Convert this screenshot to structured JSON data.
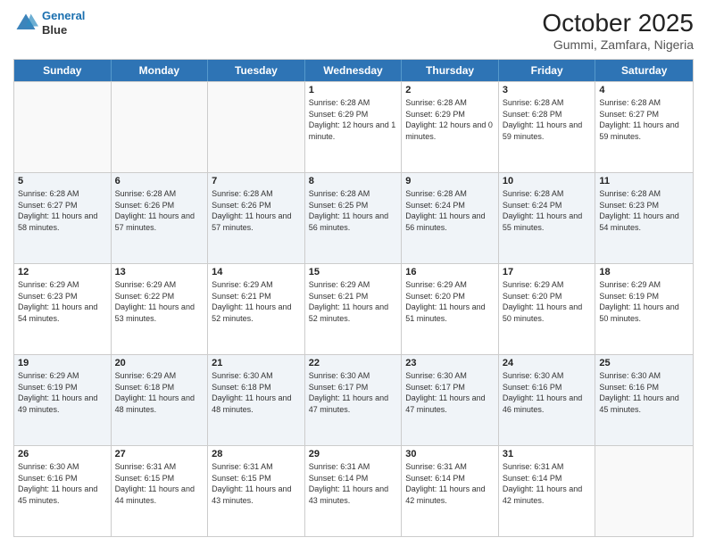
{
  "header": {
    "logo_line1": "General",
    "logo_line2": "Blue",
    "main_title": "October 2025",
    "subtitle": "Gummi, Zamfara, Nigeria"
  },
  "calendar": {
    "days": [
      "Sunday",
      "Monday",
      "Tuesday",
      "Wednesday",
      "Thursday",
      "Friday",
      "Saturday"
    ],
    "rows": [
      [
        {
          "day": "",
          "empty": true
        },
        {
          "day": "",
          "empty": true
        },
        {
          "day": "",
          "empty": true
        },
        {
          "day": "1",
          "sunrise": "6:28 AM",
          "sunset": "6:29 PM",
          "daylight": "12 hours and 1 minute."
        },
        {
          "day": "2",
          "sunrise": "6:28 AM",
          "sunset": "6:29 PM",
          "daylight": "12 hours and 0 minutes."
        },
        {
          "day": "3",
          "sunrise": "6:28 AM",
          "sunset": "6:28 PM",
          "daylight": "11 hours and 59 minutes."
        },
        {
          "day": "4",
          "sunrise": "6:28 AM",
          "sunset": "6:27 PM",
          "daylight": "11 hours and 59 minutes."
        }
      ],
      [
        {
          "day": "5",
          "sunrise": "6:28 AM",
          "sunset": "6:27 PM",
          "daylight": "11 hours and 58 minutes."
        },
        {
          "day": "6",
          "sunrise": "6:28 AM",
          "sunset": "6:26 PM",
          "daylight": "11 hours and 57 minutes."
        },
        {
          "day": "7",
          "sunrise": "6:28 AM",
          "sunset": "6:26 PM",
          "daylight": "11 hours and 57 minutes."
        },
        {
          "day": "8",
          "sunrise": "6:28 AM",
          "sunset": "6:25 PM",
          "daylight": "11 hours and 56 minutes."
        },
        {
          "day": "9",
          "sunrise": "6:28 AM",
          "sunset": "6:24 PM",
          "daylight": "11 hours and 56 minutes."
        },
        {
          "day": "10",
          "sunrise": "6:28 AM",
          "sunset": "6:24 PM",
          "daylight": "11 hours and 55 minutes."
        },
        {
          "day": "11",
          "sunrise": "6:28 AM",
          "sunset": "6:23 PM",
          "daylight": "11 hours and 54 minutes."
        }
      ],
      [
        {
          "day": "12",
          "sunrise": "6:29 AM",
          "sunset": "6:23 PM",
          "daylight": "11 hours and 54 minutes."
        },
        {
          "day": "13",
          "sunrise": "6:29 AM",
          "sunset": "6:22 PM",
          "daylight": "11 hours and 53 minutes."
        },
        {
          "day": "14",
          "sunrise": "6:29 AM",
          "sunset": "6:21 PM",
          "daylight": "11 hours and 52 minutes."
        },
        {
          "day": "15",
          "sunrise": "6:29 AM",
          "sunset": "6:21 PM",
          "daylight": "11 hours and 52 minutes."
        },
        {
          "day": "16",
          "sunrise": "6:29 AM",
          "sunset": "6:20 PM",
          "daylight": "11 hours and 51 minutes."
        },
        {
          "day": "17",
          "sunrise": "6:29 AM",
          "sunset": "6:20 PM",
          "daylight": "11 hours and 50 minutes."
        },
        {
          "day": "18",
          "sunrise": "6:29 AM",
          "sunset": "6:19 PM",
          "daylight": "11 hours and 50 minutes."
        }
      ],
      [
        {
          "day": "19",
          "sunrise": "6:29 AM",
          "sunset": "6:19 PM",
          "daylight": "11 hours and 49 minutes."
        },
        {
          "day": "20",
          "sunrise": "6:29 AM",
          "sunset": "6:18 PM",
          "daylight": "11 hours and 48 minutes."
        },
        {
          "day": "21",
          "sunrise": "6:30 AM",
          "sunset": "6:18 PM",
          "daylight": "11 hours and 48 minutes."
        },
        {
          "day": "22",
          "sunrise": "6:30 AM",
          "sunset": "6:17 PM",
          "daylight": "11 hours and 47 minutes."
        },
        {
          "day": "23",
          "sunrise": "6:30 AM",
          "sunset": "6:17 PM",
          "daylight": "11 hours and 47 minutes."
        },
        {
          "day": "24",
          "sunrise": "6:30 AM",
          "sunset": "6:16 PM",
          "daylight": "11 hours and 46 minutes."
        },
        {
          "day": "25",
          "sunrise": "6:30 AM",
          "sunset": "6:16 PM",
          "daylight": "11 hours and 45 minutes."
        }
      ],
      [
        {
          "day": "26",
          "sunrise": "6:30 AM",
          "sunset": "6:16 PM",
          "daylight": "11 hours and 45 minutes."
        },
        {
          "day": "27",
          "sunrise": "6:31 AM",
          "sunset": "6:15 PM",
          "daylight": "11 hours and 44 minutes."
        },
        {
          "day": "28",
          "sunrise": "6:31 AM",
          "sunset": "6:15 PM",
          "daylight": "11 hours and 43 minutes."
        },
        {
          "day": "29",
          "sunrise": "6:31 AM",
          "sunset": "6:14 PM",
          "daylight": "11 hours and 43 minutes."
        },
        {
          "day": "30",
          "sunrise": "6:31 AM",
          "sunset": "6:14 PM",
          "daylight": "11 hours and 42 minutes."
        },
        {
          "day": "31",
          "sunrise": "6:31 AM",
          "sunset": "6:14 PM",
          "daylight": "11 hours and 42 minutes."
        },
        {
          "day": "",
          "empty": true
        }
      ]
    ]
  }
}
